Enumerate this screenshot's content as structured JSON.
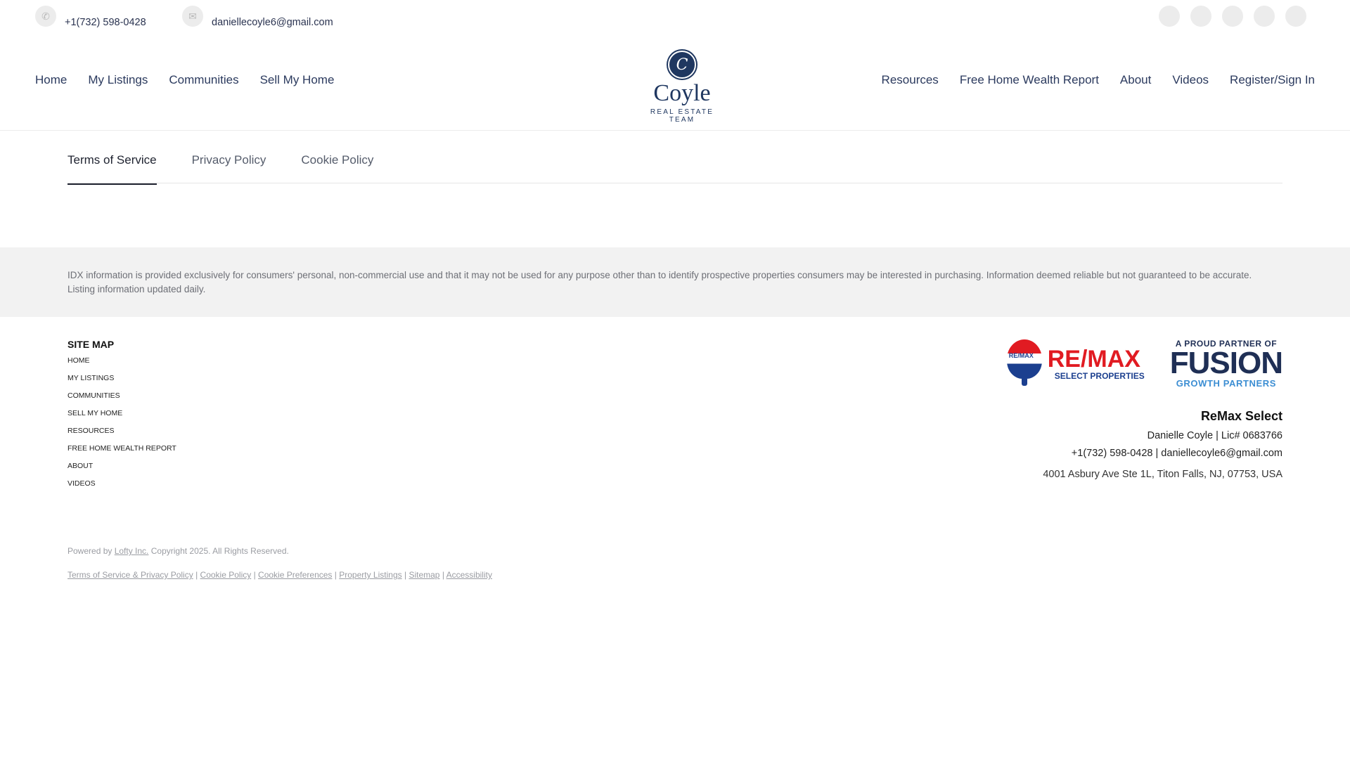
{
  "top": {
    "phone": "+1(732) 598-0428",
    "email": "daniellecoyle6@gmail.com",
    "socials": [
      "facebook-icon",
      "instagram-icon",
      "linkedin-icon",
      "youtube-icon",
      "tiktok-icon"
    ]
  },
  "nav": {
    "left": [
      "Home",
      "My Listings",
      "Communities",
      "Sell My Home"
    ],
    "right": [
      "Resources",
      "Free Home Wealth Report",
      "About",
      "Videos",
      "Register/Sign In"
    ]
  },
  "logo": {
    "initial": "C",
    "name": "Coyle",
    "subtitle": "REAL ESTATE TEAM"
  },
  "tabs": [
    "Terms of Service",
    "Privacy Policy",
    "Cookie Policy"
  ],
  "idx_text": "IDX information is provided exclusively for consumers' personal, non-commercial use and that it may not be used for any purpose other than to identify prospective properties consumers may be interested in purchasing. Information deemed reliable but not guaranteed to be accurate. Listing information updated daily.",
  "sitemap": {
    "title": "SITE MAP",
    "items": [
      "Home",
      "My Listings",
      "Communities",
      "Sell My Home",
      "Resources",
      "Free Home Wealth Report",
      "About",
      "Videos"
    ]
  },
  "partners": {
    "remax_balloon_text": "RE/MAX",
    "remax_word": "RE/MAX",
    "remax_sub": "SELECT PROPERTIES",
    "fusion_top": "A PROUD PARTNER OF",
    "fusion_word": "FUSION",
    "fusion_bottom": "GROWTH PARTNERS"
  },
  "agent": {
    "brokerage": "ReMax Select",
    "name_license": "Danielle Coyle  |  Lic# 0683766",
    "contact": "+1(732) 598-0428  |  daniellecoyle6@gmail.com",
    "address": "4001 Asbury Ave Ste 1L, Titon Falls, NJ, 07753, USA"
  },
  "footer": {
    "powered_prefix": "Powered by ",
    "powered_link": "Lofty Inc.",
    "powered_suffix": " Copyright 2025. All Rights Reserved.",
    "legal_links": [
      "Terms of Service & Privacy Policy",
      "Cookie Policy",
      "Cookie Preferences",
      "Property Listings",
      "Sitemap",
      "Accessibility"
    ],
    "separator": "|"
  }
}
